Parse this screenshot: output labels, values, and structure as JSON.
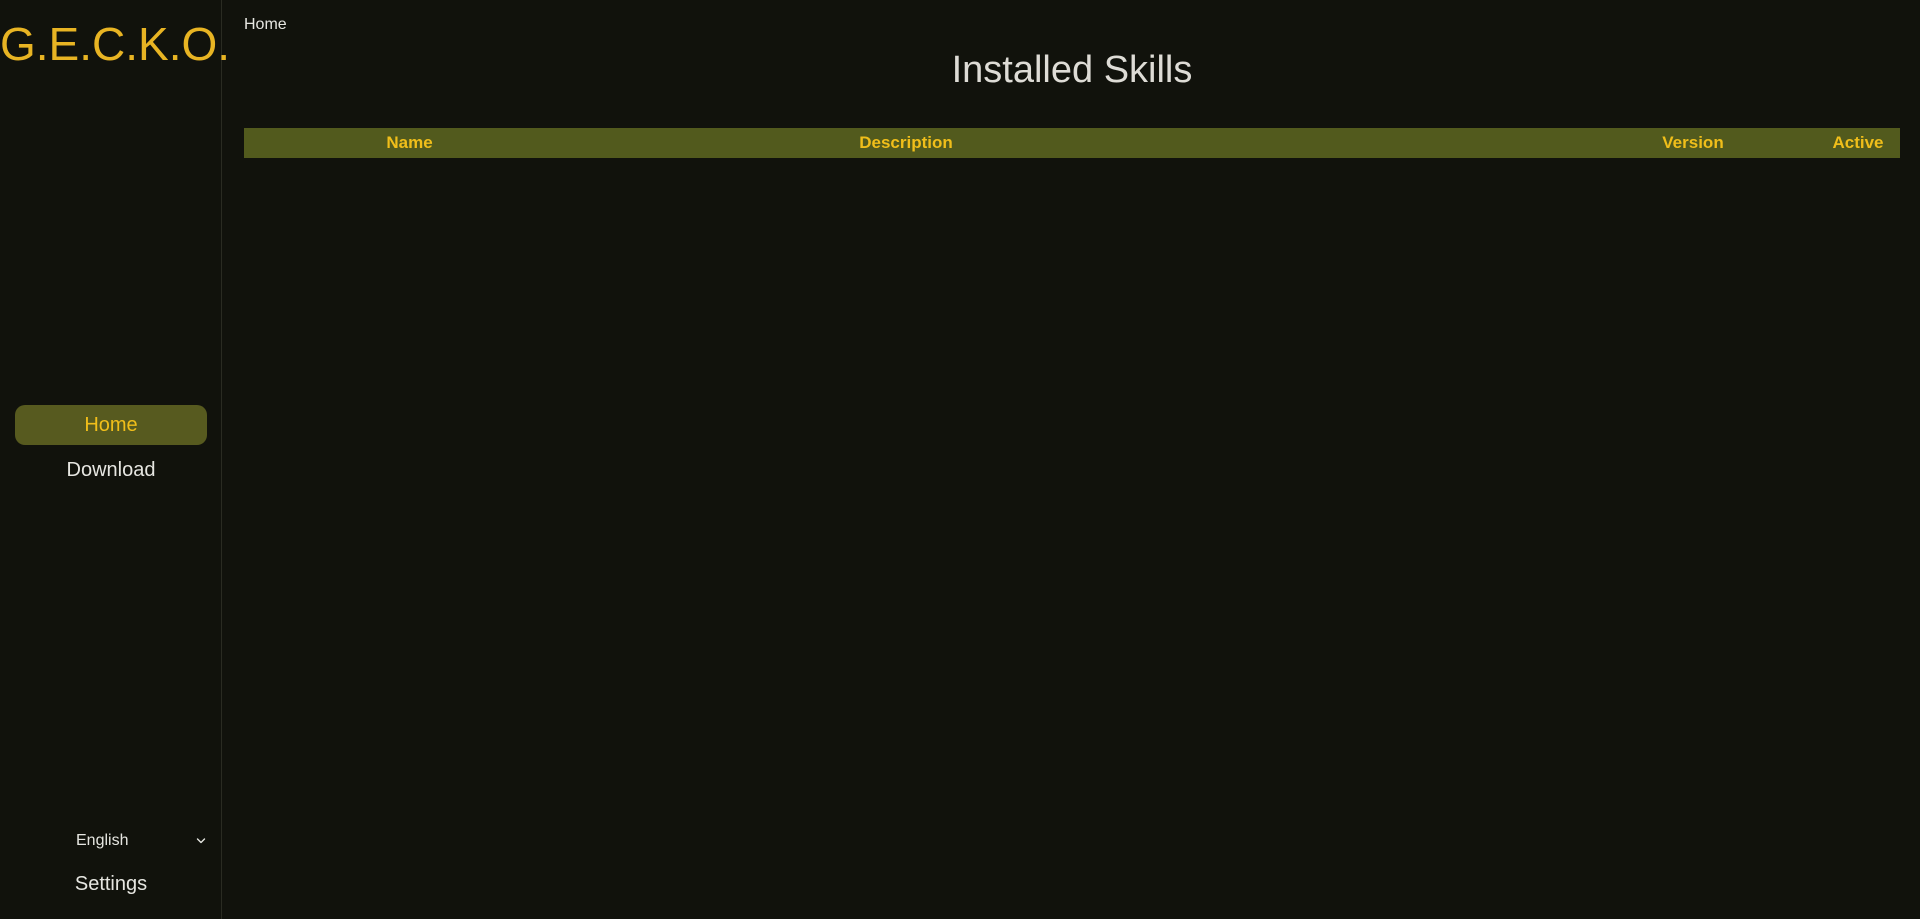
{
  "sidebar": {
    "logo": "G.E.C.K.O.",
    "nav": [
      {
        "label": "Home",
        "active": true
      },
      {
        "label": "Download",
        "active": false
      }
    ],
    "language": {
      "selected": "English",
      "icon": "chevron-down-icon"
    },
    "settings_label": "Settings"
  },
  "main": {
    "breadcrumb": "Home",
    "title": "Installed Skills",
    "table": {
      "columns": [
        "Name",
        "Description",
        "Version",
        "Active"
      ],
      "rows": []
    }
  },
  "colors": {
    "background": "#11120c",
    "accent": "#f0be1a",
    "active_nav_bg": "#575a1f",
    "table_header_bg": "#525a1d",
    "text": "#e6e6e1"
  }
}
